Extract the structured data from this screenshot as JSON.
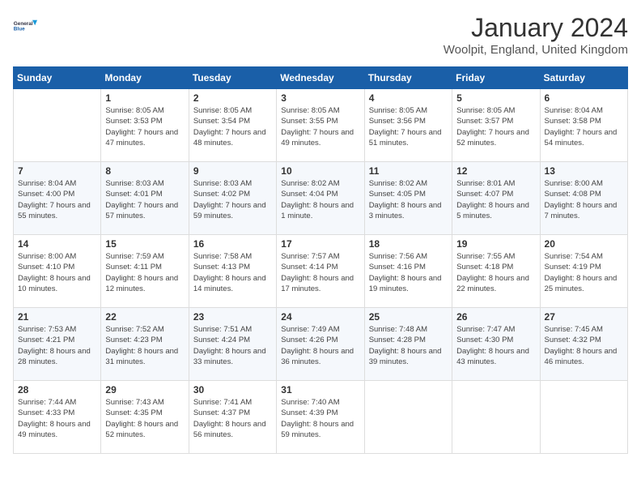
{
  "header": {
    "logo_line1": "General",
    "logo_line2": "Blue",
    "month": "January 2024",
    "location": "Woolpit, England, United Kingdom"
  },
  "days_of_week": [
    "Sunday",
    "Monday",
    "Tuesday",
    "Wednesday",
    "Thursday",
    "Friday",
    "Saturday"
  ],
  "weeks": [
    [
      {
        "day": "",
        "sunrise": "",
        "sunset": "",
        "daylight": ""
      },
      {
        "day": "1",
        "sunrise": "Sunrise: 8:05 AM",
        "sunset": "Sunset: 3:53 PM",
        "daylight": "Daylight: 7 hours and 47 minutes."
      },
      {
        "day": "2",
        "sunrise": "Sunrise: 8:05 AM",
        "sunset": "Sunset: 3:54 PM",
        "daylight": "Daylight: 7 hours and 48 minutes."
      },
      {
        "day": "3",
        "sunrise": "Sunrise: 8:05 AM",
        "sunset": "Sunset: 3:55 PM",
        "daylight": "Daylight: 7 hours and 49 minutes."
      },
      {
        "day": "4",
        "sunrise": "Sunrise: 8:05 AM",
        "sunset": "Sunset: 3:56 PM",
        "daylight": "Daylight: 7 hours and 51 minutes."
      },
      {
        "day": "5",
        "sunrise": "Sunrise: 8:05 AM",
        "sunset": "Sunset: 3:57 PM",
        "daylight": "Daylight: 7 hours and 52 minutes."
      },
      {
        "day": "6",
        "sunrise": "Sunrise: 8:04 AM",
        "sunset": "Sunset: 3:58 PM",
        "daylight": "Daylight: 7 hours and 54 minutes."
      }
    ],
    [
      {
        "day": "7",
        "sunrise": "Sunrise: 8:04 AM",
        "sunset": "Sunset: 4:00 PM",
        "daylight": "Daylight: 7 hours and 55 minutes."
      },
      {
        "day": "8",
        "sunrise": "Sunrise: 8:03 AM",
        "sunset": "Sunset: 4:01 PM",
        "daylight": "Daylight: 7 hours and 57 minutes."
      },
      {
        "day": "9",
        "sunrise": "Sunrise: 8:03 AM",
        "sunset": "Sunset: 4:02 PM",
        "daylight": "Daylight: 7 hours and 59 minutes."
      },
      {
        "day": "10",
        "sunrise": "Sunrise: 8:02 AM",
        "sunset": "Sunset: 4:04 PM",
        "daylight": "Daylight: 8 hours and 1 minute."
      },
      {
        "day": "11",
        "sunrise": "Sunrise: 8:02 AM",
        "sunset": "Sunset: 4:05 PM",
        "daylight": "Daylight: 8 hours and 3 minutes."
      },
      {
        "day": "12",
        "sunrise": "Sunrise: 8:01 AM",
        "sunset": "Sunset: 4:07 PM",
        "daylight": "Daylight: 8 hours and 5 minutes."
      },
      {
        "day": "13",
        "sunrise": "Sunrise: 8:00 AM",
        "sunset": "Sunset: 4:08 PM",
        "daylight": "Daylight: 8 hours and 7 minutes."
      }
    ],
    [
      {
        "day": "14",
        "sunrise": "Sunrise: 8:00 AM",
        "sunset": "Sunset: 4:10 PM",
        "daylight": "Daylight: 8 hours and 10 minutes."
      },
      {
        "day": "15",
        "sunrise": "Sunrise: 7:59 AM",
        "sunset": "Sunset: 4:11 PM",
        "daylight": "Daylight: 8 hours and 12 minutes."
      },
      {
        "day": "16",
        "sunrise": "Sunrise: 7:58 AM",
        "sunset": "Sunset: 4:13 PM",
        "daylight": "Daylight: 8 hours and 14 minutes."
      },
      {
        "day": "17",
        "sunrise": "Sunrise: 7:57 AM",
        "sunset": "Sunset: 4:14 PM",
        "daylight": "Daylight: 8 hours and 17 minutes."
      },
      {
        "day": "18",
        "sunrise": "Sunrise: 7:56 AM",
        "sunset": "Sunset: 4:16 PM",
        "daylight": "Daylight: 8 hours and 19 minutes."
      },
      {
        "day": "19",
        "sunrise": "Sunrise: 7:55 AM",
        "sunset": "Sunset: 4:18 PM",
        "daylight": "Daylight: 8 hours and 22 minutes."
      },
      {
        "day": "20",
        "sunrise": "Sunrise: 7:54 AM",
        "sunset": "Sunset: 4:19 PM",
        "daylight": "Daylight: 8 hours and 25 minutes."
      }
    ],
    [
      {
        "day": "21",
        "sunrise": "Sunrise: 7:53 AM",
        "sunset": "Sunset: 4:21 PM",
        "daylight": "Daylight: 8 hours and 28 minutes."
      },
      {
        "day": "22",
        "sunrise": "Sunrise: 7:52 AM",
        "sunset": "Sunset: 4:23 PM",
        "daylight": "Daylight: 8 hours and 31 minutes."
      },
      {
        "day": "23",
        "sunrise": "Sunrise: 7:51 AM",
        "sunset": "Sunset: 4:24 PM",
        "daylight": "Daylight: 8 hours and 33 minutes."
      },
      {
        "day": "24",
        "sunrise": "Sunrise: 7:49 AM",
        "sunset": "Sunset: 4:26 PM",
        "daylight": "Daylight: 8 hours and 36 minutes."
      },
      {
        "day": "25",
        "sunrise": "Sunrise: 7:48 AM",
        "sunset": "Sunset: 4:28 PM",
        "daylight": "Daylight: 8 hours and 39 minutes."
      },
      {
        "day": "26",
        "sunrise": "Sunrise: 7:47 AM",
        "sunset": "Sunset: 4:30 PM",
        "daylight": "Daylight: 8 hours and 43 minutes."
      },
      {
        "day": "27",
        "sunrise": "Sunrise: 7:45 AM",
        "sunset": "Sunset: 4:32 PM",
        "daylight": "Daylight: 8 hours and 46 minutes."
      }
    ],
    [
      {
        "day": "28",
        "sunrise": "Sunrise: 7:44 AM",
        "sunset": "Sunset: 4:33 PM",
        "daylight": "Daylight: 8 hours and 49 minutes."
      },
      {
        "day": "29",
        "sunrise": "Sunrise: 7:43 AM",
        "sunset": "Sunset: 4:35 PM",
        "daylight": "Daylight: 8 hours and 52 minutes."
      },
      {
        "day": "30",
        "sunrise": "Sunrise: 7:41 AM",
        "sunset": "Sunset: 4:37 PM",
        "daylight": "Daylight: 8 hours and 56 minutes."
      },
      {
        "day": "31",
        "sunrise": "Sunrise: 7:40 AM",
        "sunset": "Sunset: 4:39 PM",
        "daylight": "Daylight: 8 hours and 59 minutes."
      },
      {
        "day": "",
        "sunrise": "",
        "sunset": "",
        "daylight": ""
      },
      {
        "day": "",
        "sunrise": "",
        "sunset": "",
        "daylight": ""
      },
      {
        "day": "",
        "sunrise": "",
        "sunset": "",
        "daylight": ""
      }
    ]
  ]
}
